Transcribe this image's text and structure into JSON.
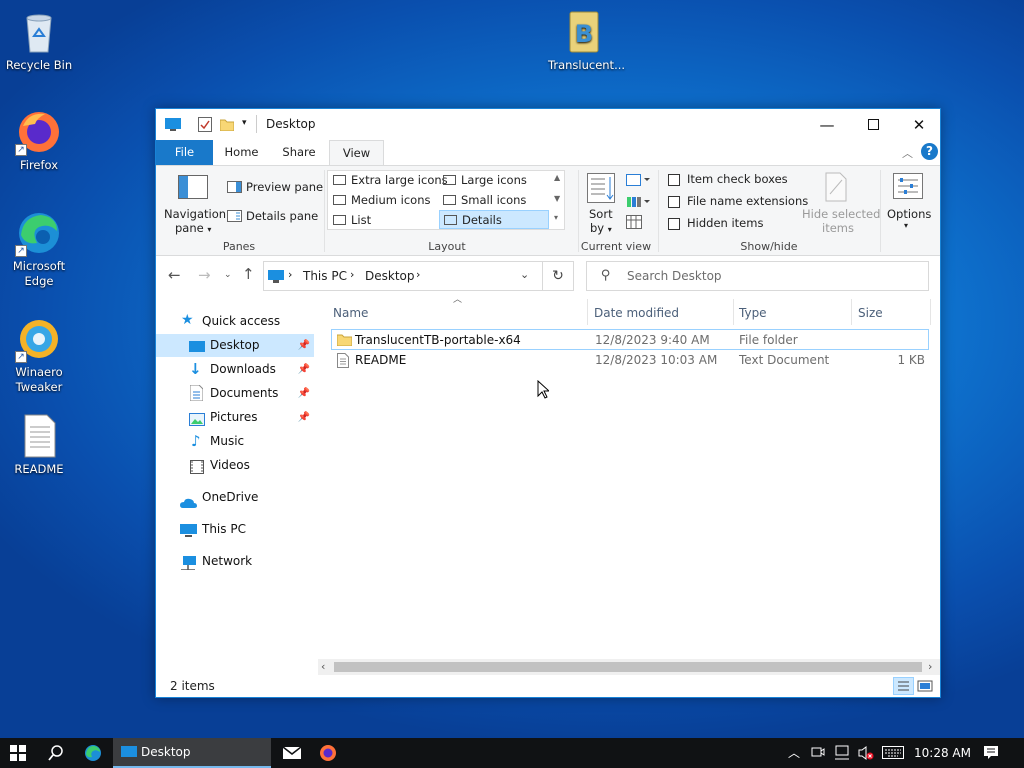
{
  "desktop": {
    "icons": [
      {
        "label": "Recycle Bin",
        "icon": "recycle-bin-icon"
      },
      {
        "label": "Firefox",
        "icon": "firefox-icon"
      },
      {
        "label": "Microsoft Edge",
        "icon": "edge-icon"
      },
      {
        "label": "Winaero Tweaker",
        "icon": "winaero-tweaker-icon"
      },
      {
        "label": "README",
        "icon": "text-file-icon"
      },
      {
        "label": "Translucent...",
        "icon": "translucenttb-icon"
      }
    ]
  },
  "window": {
    "title": "Desktop",
    "tabs": {
      "file": "File",
      "home": "Home",
      "share": "Share",
      "view": "View"
    },
    "ribbon": {
      "panes": {
        "navigation_pane": "Navigation",
        "navigation_pane2": "pane",
        "preview_pane": "Preview pane",
        "details_pane": "Details pane",
        "label": "Panes"
      },
      "layout": {
        "items": [
          "Extra large icons",
          "Large icons",
          "Medium icons",
          "Small icons",
          "List",
          "Details"
        ],
        "selected": "Details",
        "label": "Layout"
      },
      "current_view": {
        "sort_by": "Sort",
        "sort_by2": "by",
        "label": "Current view"
      },
      "show_hide": {
        "item_check_boxes": "Item check boxes",
        "file_name_extensions": "File name extensions",
        "hidden_items": "Hidden items",
        "hide_selected": "Hide selected",
        "hide_selected2": "items",
        "label": "Show/hide"
      },
      "options": "Options"
    },
    "address": {
      "segments": [
        "This PC",
        "Desktop"
      ]
    },
    "search": {
      "placeholder": "Search Desktop"
    },
    "nav": {
      "quick_access": "Quick access",
      "items": [
        {
          "label": "Desktop",
          "pinned": true,
          "selected": true
        },
        {
          "label": "Downloads",
          "pinned": true
        },
        {
          "label": "Documents",
          "pinned": true
        },
        {
          "label": "Pictures",
          "pinned": true
        },
        {
          "label": "Music"
        },
        {
          "label": "Videos"
        }
      ],
      "onedrive": "OneDrive",
      "this_pc": "This PC",
      "network": "Network"
    },
    "columns": {
      "name": "Name",
      "date": "Date modified",
      "type": "Type",
      "size": "Size"
    },
    "files": [
      {
        "name": "TranslucentTB-portable-x64",
        "date": "12/8/2023 9:40 AM",
        "type": "File folder",
        "size": ""
      },
      {
        "name": "README",
        "date": "12/8/2023 10:03 AM",
        "type": "Text Document",
        "size": "1 KB"
      }
    ],
    "status": "2 items"
  },
  "taskbar": {
    "active_window": "Desktop",
    "clock": "10:28 AM"
  },
  "colors": {
    "accent": "#1979ca",
    "selection": "#cce8ff",
    "taskbar": "#101214"
  }
}
